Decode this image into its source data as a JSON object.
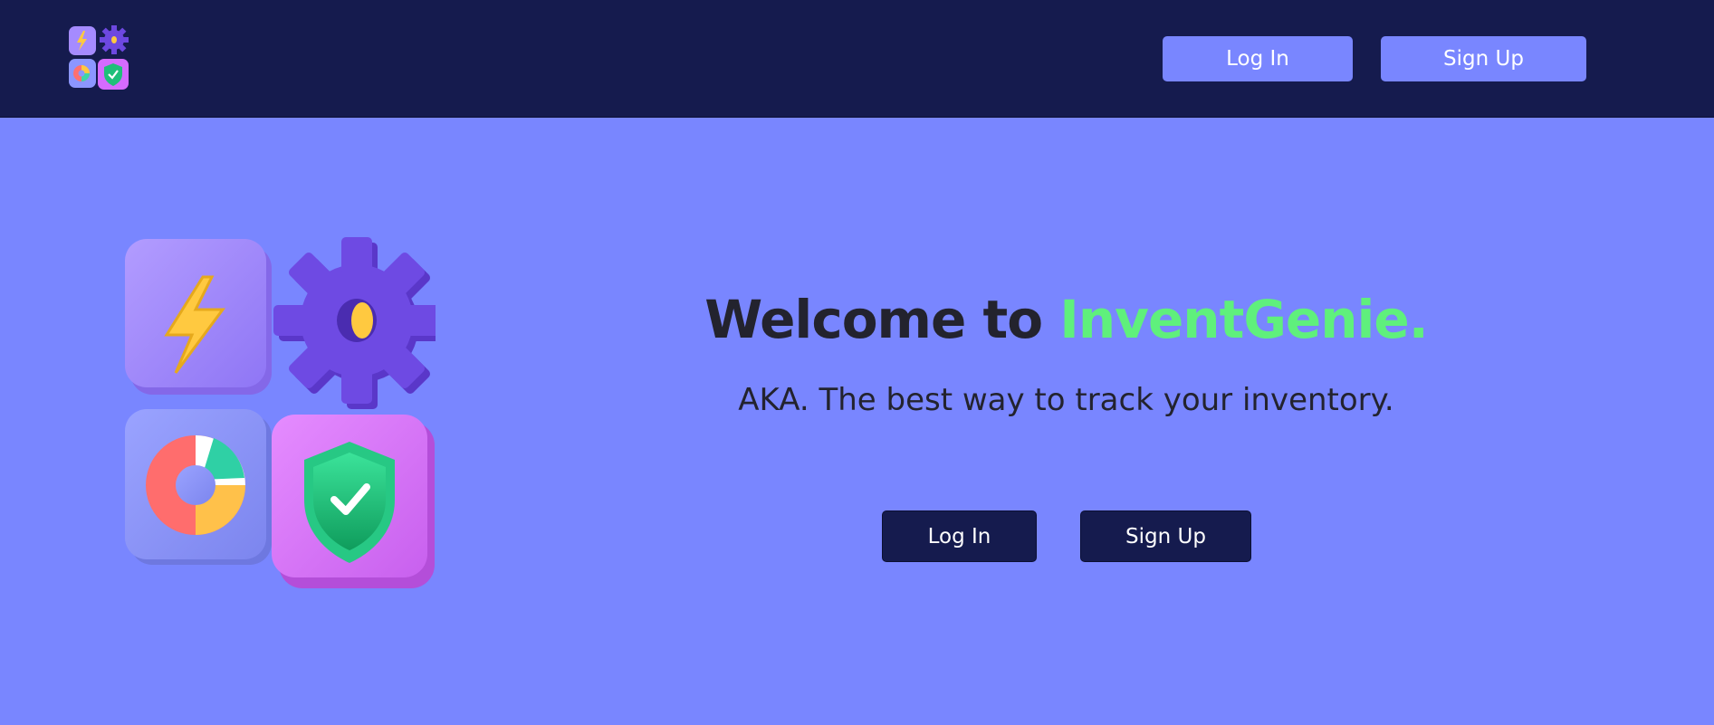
{
  "navbar": {
    "logo_icon": "app-grid-logo-icon",
    "login_label": "Log In",
    "signup_label": "Sign Up"
  },
  "hero": {
    "headline_prefix": "Welcome to ",
    "headline_brand": "InventGenie.",
    "tagline": "AKA. The best way to track your inventory.",
    "login_label": "Log In",
    "signup_label": "Sign Up",
    "illustration_icons": [
      "lightning-icon",
      "gear-icon",
      "pie-chart-icon",
      "shield-check-icon"
    ]
  },
  "colors": {
    "navbar_bg": "#151b4e",
    "page_bg": "#7986ff",
    "brand_accent": "#5ff07c",
    "text_dark": "#23232e"
  }
}
